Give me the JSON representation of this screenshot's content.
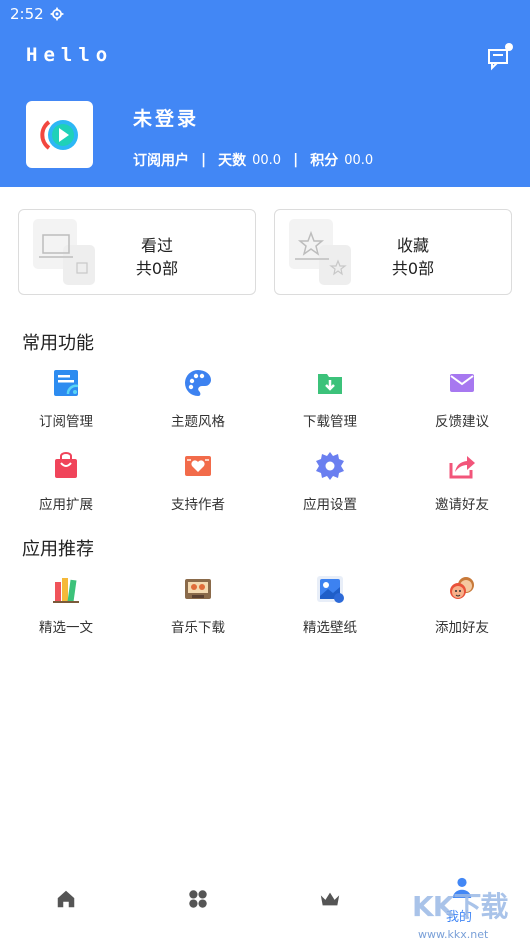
{
  "status_bar": {
    "time": "2:52",
    "settings_icon": "gear-icon"
  },
  "header": {
    "title": "Hello",
    "message_icon": "message-icon",
    "user": {
      "name": "未登录",
      "role": "订阅用户",
      "days_label": "天数",
      "days_value": "00.0",
      "points_label": "积分",
      "points_value": "00.0",
      "separator": "|"
    },
    "accent_color": "#4287f5"
  },
  "cards": [
    {
      "title": "看过",
      "count": "共0部",
      "icon": "history-illustration"
    },
    {
      "title": "收藏",
      "count": "共0部",
      "icon": "favorites-illustration"
    }
  ],
  "common_section": {
    "title": "常用功能",
    "items": [
      {
        "label": "订阅管理",
        "icon": "subscription-icon"
      },
      {
        "label": "主题风格",
        "icon": "palette-icon"
      },
      {
        "label": "下载管理",
        "icon": "download-folder-icon"
      },
      {
        "label": "反馈建议",
        "icon": "mail-icon"
      },
      {
        "label": "应用扩展",
        "icon": "shopping-bag-icon"
      },
      {
        "label": "支持作者",
        "icon": "heart-card-icon"
      },
      {
        "label": "应用设置",
        "icon": "settings-gear-icon"
      },
      {
        "label": "邀请好友",
        "icon": "share-icon"
      }
    ]
  },
  "recommend_section": {
    "title": "应用推荐",
    "items": [
      {
        "label": "精选一文",
        "icon": "books-icon"
      },
      {
        "label": "音乐下载",
        "icon": "cassette-icon"
      },
      {
        "label": "精选壁纸",
        "icon": "wallpaper-icon"
      },
      {
        "label": "添加好友",
        "icon": "friends-icon"
      }
    ]
  },
  "bottom_nav": {
    "items": [
      {
        "icon": "home-icon"
      },
      {
        "icon": "grid-icon"
      },
      {
        "icon": "crown-icon"
      },
      {
        "icon": "profile-icon",
        "label": "我的",
        "active": true
      }
    ]
  },
  "watermark": {
    "text": "KK下载",
    "url": "www.kkx.net"
  }
}
